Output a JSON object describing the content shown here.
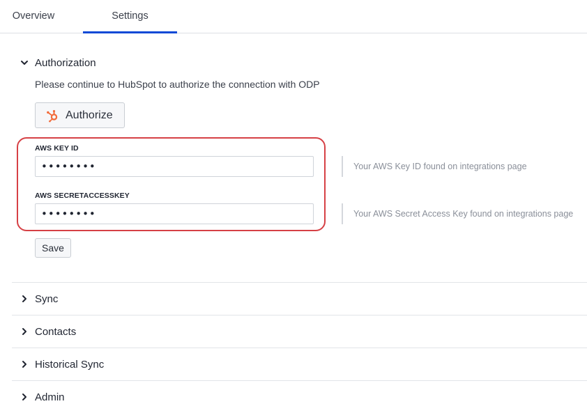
{
  "tabs": [
    {
      "label": "Overview",
      "active": false
    },
    {
      "label": "Settings",
      "active": true
    }
  ],
  "accent_color": "#0b49d6",
  "highlight_color": "#d64045",
  "authorization": {
    "title": "Authorization",
    "expanded": true,
    "description": "Please continue to HubSpot to authorize the connection with ODP",
    "authorize_button": "Authorize",
    "authorize_icon": "hubspot-logo-icon",
    "fields": [
      {
        "label": "AWS KEY ID",
        "value": "••••••••",
        "help": "Your AWS Key ID found on integrations page"
      },
      {
        "label": "AWS SECRETACCESSKEY",
        "value": "••••••••",
        "help": "Your AWS Secret Access Key found on integrations page"
      }
    ],
    "save_button": "Save"
  },
  "sections": [
    {
      "title": "Sync",
      "expanded": false
    },
    {
      "title": "Contacts",
      "expanded": false
    },
    {
      "title": "Historical Sync",
      "expanded": false
    },
    {
      "title": "Admin",
      "expanded": false
    }
  ]
}
